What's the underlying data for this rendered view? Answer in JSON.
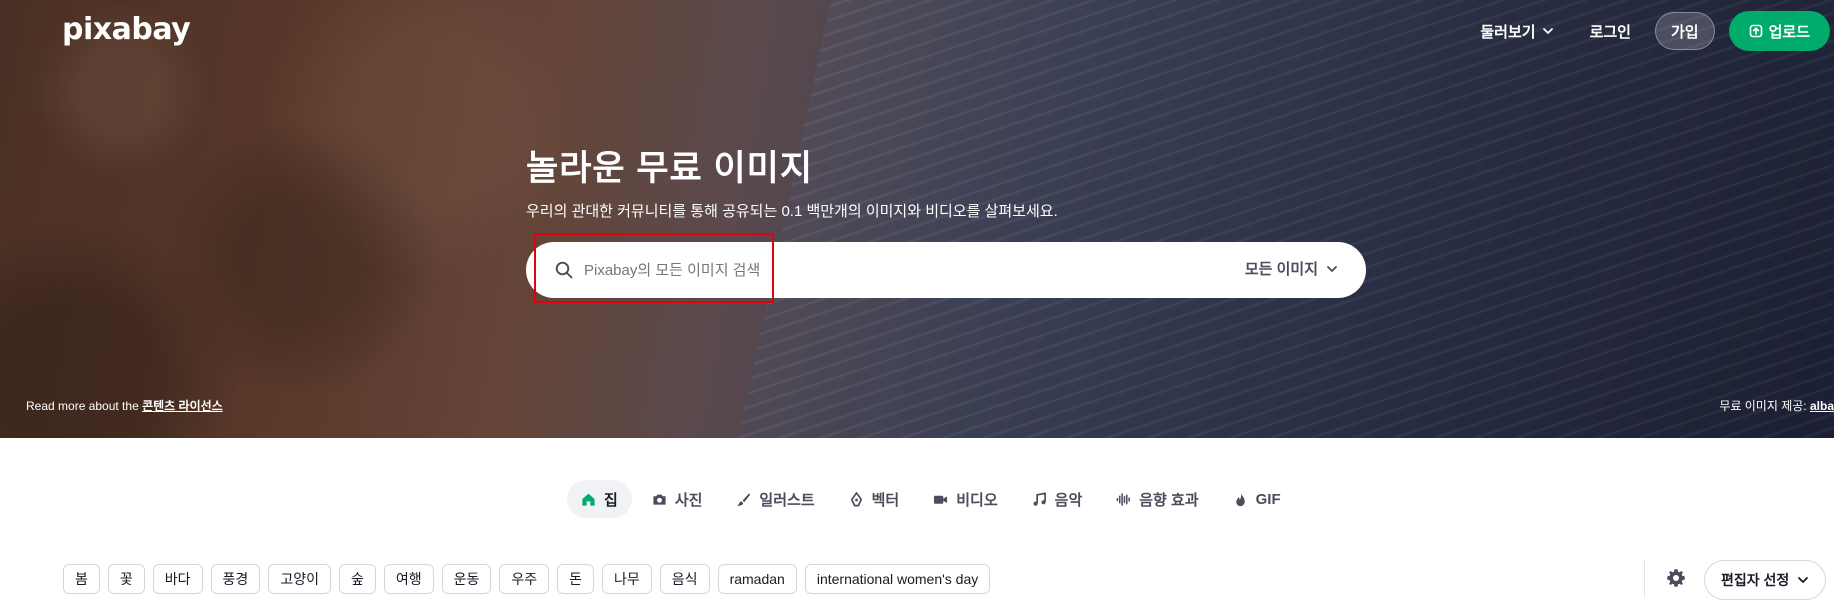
{
  "brand": {
    "logo_text": "pixabay"
  },
  "topnav": {
    "explore_label": "둘러보기",
    "login_label": "로그인",
    "signup_label": "가입",
    "upload_label": "업로드",
    "accent_color": "#00ab6b"
  },
  "hero": {
    "title": "놀라운 무료 이미지",
    "subtitle": "우리의 관대한 커뮤니티를 통해 공유되는 0.1 백만개의 이미지와 비디오를 살펴보세요.",
    "search": {
      "placeholder": "Pixabay의 모든 이미지 검색",
      "value": "",
      "scope_label": "모든 이미지"
    },
    "license_prefix": "Read more about the",
    "license_link": "콘텐츠 라이선스",
    "credit_prefix": "무료 이미지 제공:",
    "credit_link": "alba"
  },
  "categories": [
    {
      "label": "집",
      "icon": "home-icon",
      "active": true
    },
    {
      "label": "사진",
      "icon": "camera-icon",
      "active": false
    },
    {
      "label": "일러스트",
      "icon": "brush-icon",
      "active": false
    },
    {
      "label": "벡터",
      "icon": "pen-nib-icon",
      "active": false
    },
    {
      "label": "비디오",
      "icon": "video-camera-icon",
      "active": false
    },
    {
      "label": "음악",
      "icon": "music-note-icon",
      "active": false
    },
    {
      "label": "음향 효과",
      "icon": "sound-wave-icon",
      "active": false
    },
    {
      "label": "GIF",
      "icon": "flame-icon",
      "active": false
    }
  ],
  "tags": [
    "봄",
    "꽃",
    "바다",
    "풍경",
    "고양이",
    "숲",
    "여행",
    "운동",
    "우주",
    "돈",
    "나무",
    "음식",
    "ramadan",
    "international women's day"
  ],
  "sort": {
    "label": "편집자 선정"
  }
}
